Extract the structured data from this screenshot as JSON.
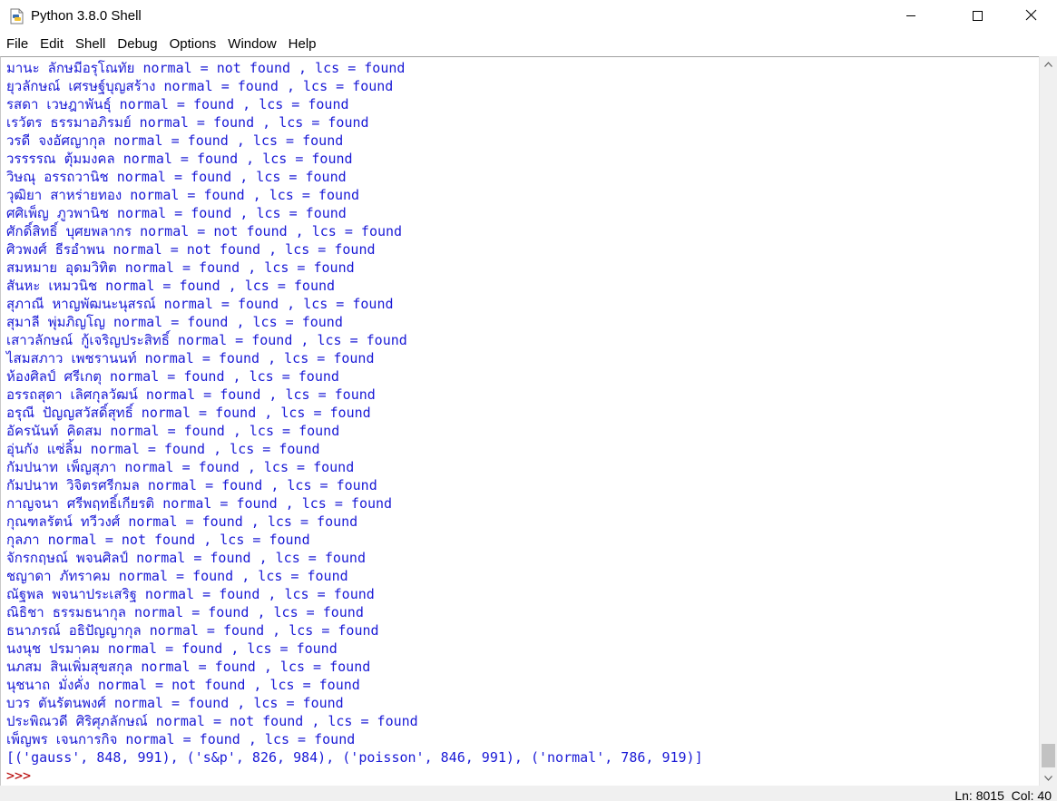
{
  "window": {
    "title": "Python 3.8.0 Shell",
    "icon": "python-idle-icon"
  },
  "menubar": {
    "items": [
      "File",
      "Edit",
      "Shell",
      "Debug",
      "Options",
      "Window",
      "Help"
    ]
  },
  "colors": {
    "output_text": "#1a1ad6",
    "prompt": "#b50000",
    "background": "#ffffff"
  },
  "shell": {
    "lines": [
      "มานะ ลักษมีอรุโณทัย normal = not found , lcs = found",
      "ยุวลักษณ์ เศรษฐ์บุญสร้าง normal = found , lcs = found",
      "รสดา เวษฎาพันธุ์ normal = found , lcs = found",
      "เรวัตร ธรรมาอภิรมย์ normal = found , lcs = found",
      "วรดี จงอัศญากุล normal = found , lcs = found",
      "วรรรรณ ตุ้มมงคล normal = found , lcs = found",
      "วิษณุ อรรถวานิช normal = found , lcs = found",
      "วุฒิยา สาหร่ายทอง normal = found , lcs = found",
      "ศศิเพ็ญ ภูวพานิช normal = found , lcs = found",
      "ศักดิ์สิทธิ์ บุศยพลากร normal = not found , lcs = found",
      "ศิวพงศ์ ธีรอำพน normal = not found , lcs = found",
      "สมหมาย อุดมวิทิต normal = found , lcs = found",
      "สันหะ เหมวนิช normal = found , lcs = found",
      "สุภาณี หาญพัฒนะนุสรณ์ normal = found , lcs = found",
      "สุมาลี พุ่มภิญโญ normal = found , lcs = found",
      "เสาวลักษณ์ กู้เจริญประสิทธิ์ normal = found , lcs = found",
      "ไสมสภาว เพชรานนท์ normal = found , lcs = found",
      "ห้องศิลป์ ศรีเกตุ normal = found , lcs = found",
      "อรรถสุดา เลิศกุลวัฒน์ normal = found , lcs = found",
      "อรุณี ปัญญสวัสดิ์สุทธิ์ normal = found , lcs = found",
      "อัครนันท์ คิดสม normal = found , lcs = found",
      "อุ่นกัง แซ่ลิ้ม normal = found , lcs = found",
      "กัมปนาท เพ็ญสุภา normal = found , lcs = found",
      "กัมปนาท วิจิตรศรีกมล normal = found , lcs = found",
      "กาญจนา ศรีพฤทธิ์เกียรติ normal = found , lcs = found",
      "กุณฑลรัตน์ ทวีวงศ์ normal = found , lcs = found",
      "กุลภา normal = not found , lcs = found",
      "จักรกฤษณ์ พจนศิลป์ normal = found , lcs = found",
      "ชญาดา ภัทราคม normal = found , lcs = found",
      "ณัฐพล พจนาประเสริฐ normal = found , lcs = found",
      "ณิธิชา ธรรมธนากุล normal = found , lcs = found",
      "ธนาภรณ์ อธิปัญญากุล normal = found , lcs = found",
      "นงนุช ปรมาคม normal = found , lcs = found",
      "นภสม สินเพิ่มสุขสกุล normal = found , lcs = found",
      "นุชนาถ มั่งคั่ง normal = not found , lcs = found",
      "บวร ตันรัตนพงศ์ normal = found , lcs = found",
      "ประพิณวดี ศิริศุภลักษณ์ normal = not found , lcs = found",
      "เพ็ญพร เจนการกิจ normal = found , lcs = found",
      "[('gauss', 848, 991), ('s&p', 826, 984), ('poisson', 846, 991), ('normal', 786, 919)]"
    ],
    "prompt": ">>>"
  },
  "statusbar": {
    "text": "Ln: 8015  Col: 40"
  }
}
